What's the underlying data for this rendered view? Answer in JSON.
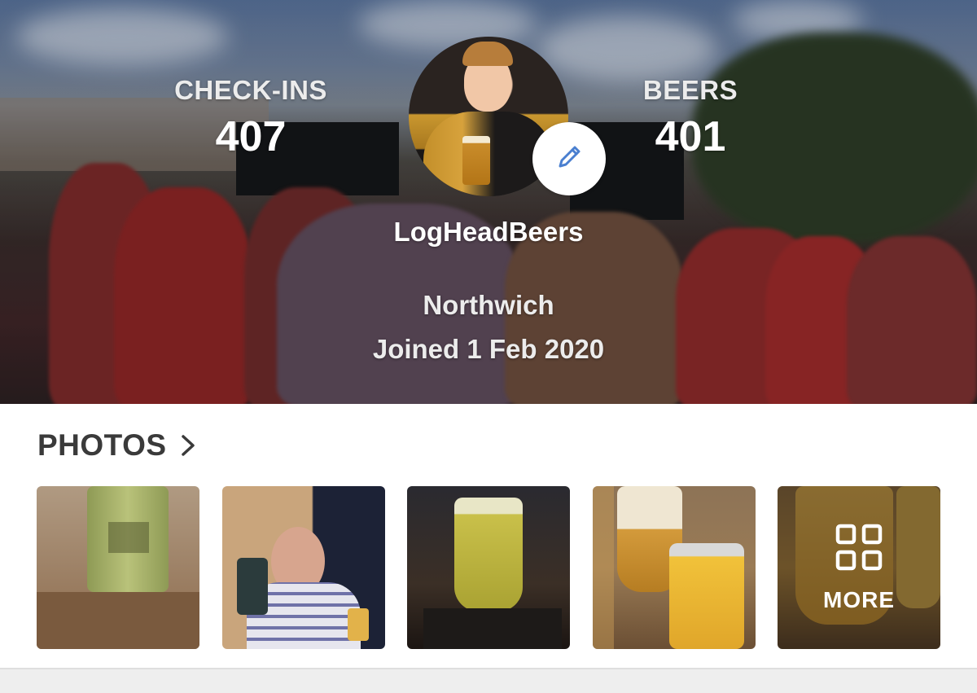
{
  "profile": {
    "checkins_label": "CHECK-INS",
    "checkins_value": "407",
    "beers_label": "BEERS",
    "beers_value": "401",
    "username": "LogHeadBeers",
    "location": "Northwich",
    "joined": "Joined 1 Feb 2020"
  },
  "photos": {
    "title": "PHOTOS",
    "more_label": "MORE",
    "thumbnails": [
      "photo-1",
      "photo-2",
      "photo-3",
      "photo-4",
      "photo-5"
    ]
  },
  "icons": {
    "edit": "pencil-icon",
    "photos_link": "chevron-right-icon",
    "more": "grid-icon"
  },
  "colors": {
    "accent": "#4a7fd0",
    "heading": "#3a3a3a",
    "divider": "#eeeeee"
  }
}
